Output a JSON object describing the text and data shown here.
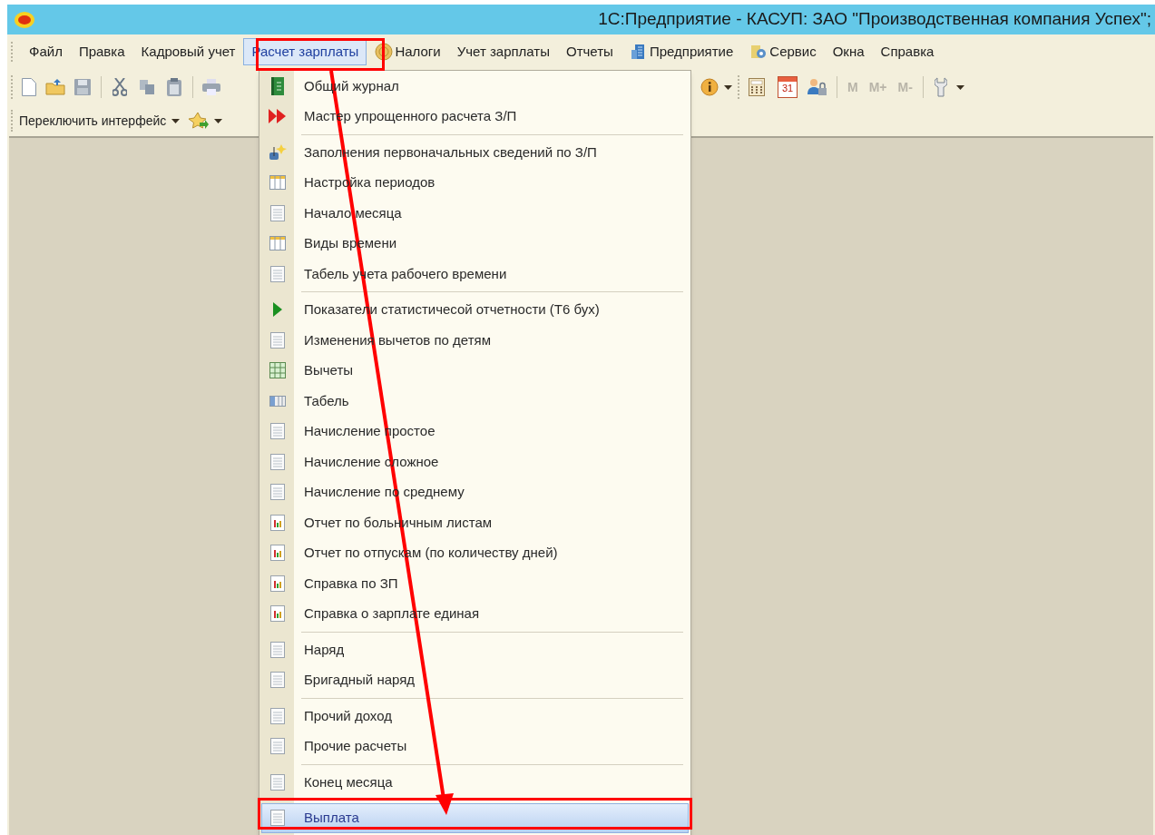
{
  "window": {
    "title": "1С:Предприятие - КАСУП: ЗАО \"Производственная компания Успех\";"
  },
  "menubar": [
    {
      "label": "Файл",
      "kind": "text",
      "selected": false
    },
    {
      "label": "Правка",
      "kind": "text",
      "selected": false
    },
    {
      "label": "Кадровый учет",
      "kind": "text",
      "selected": false
    },
    {
      "label": "Расчет зарплаты",
      "kind": "text",
      "selected": true
    },
    {
      "label": "Налоги",
      "kind": "coin",
      "selected": false
    },
    {
      "label": "Учет зарплаты",
      "kind": "text",
      "selected": false
    },
    {
      "label": "Отчеты",
      "kind": "text",
      "selected": false
    },
    {
      "label": "Предприятие",
      "kind": "building",
      "selected": false
    },
    {
      "label": "Сервис",
      "kind": "gear",
      "selected": false
    },
    {
      "label": "Окна",
      "kind": "text",
      "selected": false
    },
    {
      "label": "Справка",
      "kind": "text",
      "selected": false
    }
  ],
  "toolbar_left": [
    {
      "kind": "new"
    },
    {
      "kind": "open"
    },
    {
      "kind": "save"
    },
    {
      "kind": "separator"
    },
    {
      "kind": "cut"
    },
    {
      "kind": "copy"
    },
    {
      "kind": "paste"
    },
    {
      "kind": "separator"
    },
    {
      "kind": "print"
    }
  ],
  "toolbar_right": [
    {
      "kind": "info"
    },
    {
      "kind": "grip"
    },
    {
      "kind": "calculator"
    },
    {
      "kind": "calendar",
      "text": "31"
    },
    {
      "kind": "users"
    },
    {
      "kind": "separator"
    },
    {
      "kind": "memory",
      "label": "M",
      "disabled": true
    },
    {
      "kind": "memory",
      "label": "M+",
      "disabled": true
    },
    {
      "kind": "memory",
      "label": "M-",
      "disabled": true
    },
    {
      "kind": "separator"
    },
    {
      "kind": "wrench"
    }
  ],
  "interface_switch": {
    "label": "Переключить интерфейс"
  },
  "menu": [
    {
      "kind": "journal",
      "label": "Общий журнал",
      "selected": false
    },
    {
      "kind": "wizard",
      "label": "Мастер упрощенного расчета З/П",
      "selected": false
    },
    {
      "kind": "separator"
    },
    {
      "kind": "fill",
      "label": "Заполнения первоначальных сведений по З/П",
      "selected": false
    },
    {
      "kind": "columns",
      "label": "Настройка периодов",
      "selected": false
    },
    {
      "kind": "doc",
      "label": "Начало месяца",
      "selected": false
    },
    {
      "kind": "columns",
      "label": "Виды времени",
      "selected": false
    },
    {
      "kind": "doc",
      "label": "Табель учета рабочего времени",
      "selected": false
    },
    {
      "kind": "separator"
    },
    {
      "kind": "play",
      "label": "Показатели статистичесой отчетности (Т6 бух)",
      "selected": false
    },
    {
      "kind": "doc",
      "label": "Изменения вычетов по детям",
      "selected": false
    },
    {
      "kind": "table",
      "label": "Вычеты",
      "selected": false
    },
    {
      "kind": "timesheet",
      "label": "Табель",
      "selected": false
    },
    {
      "kind": "doc",
      "label": "Начисление простое",
      "selected": false
    },
    {
      "kind": "doc",
      "label": "Начисление сложное",
      "selected": false
    },
    {
      "kind": "doc",
      "label": "Начисление по среднему",
      "selected": false
    },
    {
      "kind": "report",
      "label": "Отчет по больничным листам",
      "selected": false
    },
    {
      "kind": "report",
      "label": "Отчет по отпускам (по количеству дней)",
      "selected": false
    },
    {
      "kind": "report",
      "label": "Справка по ЗП",
      "selected": false
    },
    {
      "kind": "report",
      "label": "Справка о зарплате единая",
      "selected": false
    },
    {
      "kind": "separator"
    },
    {
      "kind": "doc",
      "label": "Наряд",
      "selected": false
    },
    {
      "kind": "doc",
      "label": "Бригадный наряд",
      "selected": false
    },
    {
      "kind": "separator"
    },
    {
      "kind": "doc",
      "label": "Прочий доход",
      "selected": false
    },
    {
      "kind": "doc",
      "label": "Прочие расчеты",
      "selected": false
    },
    {
      "kind": "separator"
    },
    {
      "kind": "doc",
      "label": "Конец месяца",
      "selected": false
    },
    {
      "kind": "separator"
    },
    {
      "kind": "doc",
      "label": "Выплата",
      "selected": true
    }
  ]
}
